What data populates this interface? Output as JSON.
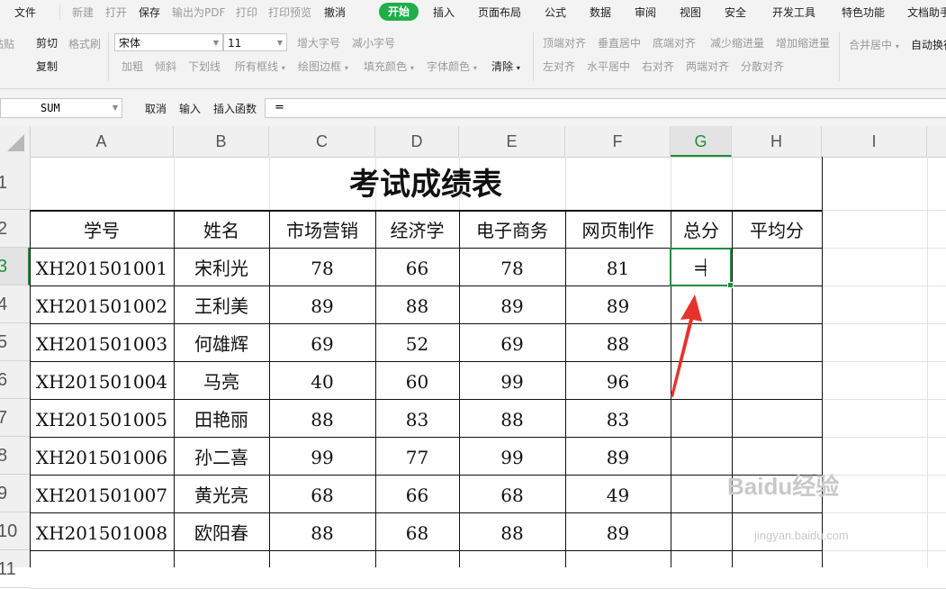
{
  "menu": {
    "file": "文件",
    "quick": [
      "新建",
      "打开",
      "保存",
      "输出为PDF",
      "打印",
      "打印预览",
      "撤消"
    ],
    "tabs": [
      "开始",
      "插入",
      "页面布局",
      "公式",
      "数据",
      "审阅",
      "视图",
      "安全",
      "开发工具",
      "特色功能",
      "文档助手"
    ]
  },
  "ribbon": {
    "paste": "粘贴",
    "cut": "剪切",
    "format_painter": "格式刷",
    "copy": "复制",
    "font_name": "宋体",
    "font_size": "11",
    "grow_font": "增大字号",
    "shrink_font": "减小字号",
    "bold": "加粗",
    "italic": "倾斜",
    "underline": "下划线",
    "all_borders": "所有框线",
    "draw_border": "绘图边框",
    "fill_color": "填充颜色",
    "font_color": "字体颜色",
    "clear": "清除",
    "top_align": "顶端对齐",
    "middle_align": "垂直居中",
    "bottom_align": "底端对齐",
    "decrease_indent": "减少缩进量",
    "increase_indent": "增加缩进量",
    "left_align": "左对齐",
    "center_align": "水平居中",
    "right_align": "右对齐",
    "justify": "两端对齐",
    "distributed": "分散对齐",
    "merge_center": "合并居中",
    "wrap_text": "自动换行"
  },
  "formula_bar": {
    "name_box": "SUM",
    "cancel": "取消",
    "enter": "输入",
    "insert_function": "插入函数",
    "value": "="
  },
  "columns": [
    "A",
    "B",
    "C",
    "D",
    "E",
    "F",
    "G",
    "H",
    "I"
  ],
  "rows": [
    "1",
    "2",
    "3",
    "4",
    "5",
    "6",
    "7",
    "8",
    "9",
    "10",
    "11"
  ],
  "sheet": {
    "title": "考试成绩表",
    "headers": [
      "学号",
      "姓名",
      "市场营销",
      "经济学",
      "电子商务",
      "网页制作",
      "总分",
      "平均分"
    ],
    "data": [
      [
        "XH201501001",
        "宋利光",
        "78",
        "66",
        "78",
        "81"
      ],
      [
        "XH201501002",
        "王利美",
        "89",
        "88",
        "89",
        "89"
      ],
      [
        "XH201501003",
        "何雄辉",
        "69",
        "52",
        "69",
        "88"
      ],
      [
        "XH201501004",
        "马亮",
        "40",
        "60",
        "99",
        "96"
      ],
      [
        "XH201501005",
        "田艳丽",
        "88",
        "83",
        "88",
        "83"
      ],
      [
        "XH201501006",
        "孙二喜",
        "99",
        "77",
        "99",
        "89"
      ],
      [
        "XH201501007",
        "黄光亮",
        "68",
        "66",
        "68",
        "49"
      ],
      [
        "XH201501008",
        "欧阳春",
        "88",
        "68",
        "88",
        "89"
      ]
    ],
    "active_cell_value": "=",
    "active_column": "G",
    "active_row": "3"
  },
  "watermark": {
    "brand": "Baidu经验",
    "url": "jingyan.baidu.com"
  },
  "colors": {
    "accent": "#1fae4a",
    "selection": "#1f8e3f",
    "arrow": "#e8322c"
  }
}
